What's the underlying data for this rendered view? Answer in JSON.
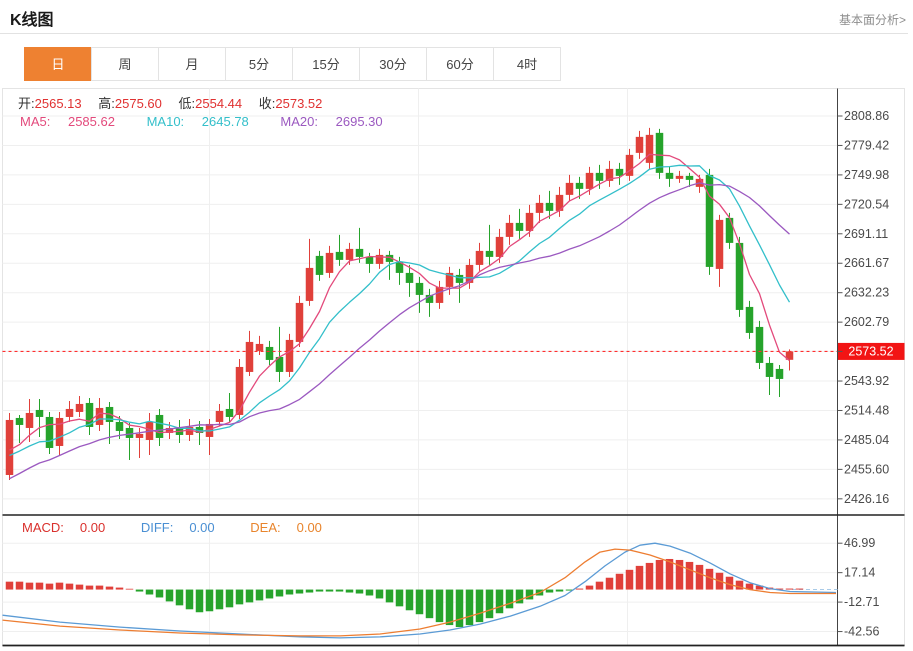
{
  "header": {
    "title": "K线图",
    "link": "基本面分析>"
  },
  "tabs": {
    "items": [
      {
        "label": "日",
        "active": true
      },
      {
        "label": "周",
        "active": false
      },
      {
        "label": "月",
        "active": false
      },
      {
        "label": "5分",
        "active": false
      },
      {
        "label": "15分",
        "active": false
      },
      {
        "label": "30分",
        "active": false
      },
      {
        "label": "60分",
        "active": false
      },
      {
        "label": "4时",
        "active": false
      }
    ]
  },
  "quote": {
    "open_label": "开:",
    "open": "2565.13",
    "high_label": "高:",
    "high": "2575.60",
    "low_label": "低:",
    "low": "2554.44",
    "close_label": "收:",
    "close": "2573.52"
  },
  "ma": {
    "ma5_label": "MA5:",
    "ma5": "2585.62",
    "ma10_label": "MA10:",
    "ma10": "2645.78",
    "ma20_label": "MA20:",
    "ma20": "2695.30"
  },
  "macd_readout": {
    "macd_label": "MACD:",
    "macd": "0.00",
    "diff_label": "DIFF:",
    "diff": "0.00",
    "dea_label": "DEA:",
    "dea": "0.00"
  },
  "colors": {
    "up": "#e0403a",
    "down": "#26a32b",
    "ma5": "#e34a7c",
    "ma10": "#33bfca",
    "ma20": "#9b59c0",
    "diff": "#5b9bd5",
    "dea": "#ed7d31",
    "tab_accent": "#ee8131",
    "price_badge": "#f21414",
    "price_line": "#ff2e2e",
    "grid": "#efefef",
    "axis": "#555555",
    "separator": "#222222",
    "tick_text": "#4a4a4a"
  },
  "chart_data": {
    "type": "candlestick+macd",
    "main": {
      "y_ticks": [
        2808.86,
        2779.42,
        2749.98,
        2720.54,
        2691.11,
        2661.67,
        2632.23,
        2602.79,
        2573.52,
        2543.92,
        2514.48,
        2485.04,
        2455.6,
        2426.16
      ],
      "current_price": 2573.52,
      "current_price_label": "2573.52",
      "ma_periods": [
        5,
        10,
        20
      ],
      "ma_seed": [
        2355,
        2362,
        2369,
        2376,
        2383,
        2390,
        2396,
        2402,
        2408,
        2414,
        2420,
        2426,
        2432,
        2438,
        2444,
        2450,
        2456,
        2461,
        2466,
        2470,
        2468,
        2472,
        2465,
        2470,
        2462
      ],
      "candles_format": [
        "open",
        "close",
        "high",
        "low"
      ],
      "candles": [
        [
          2450,
          2505,
          2512,
          2445
        ],
        [
          2507,
          2500,
          2510,
          2482
        ],
        [
          2497,
          2512,
          2526,
          2483
        ],
        [
          2515,
          2508,
          2526,
          2488
        ],
        [
          2508,
          2477,
          2513,
          2471
        ],
        [
          2479,
          2507,
          2513,
          2470
        ],
        [
          2508,
          2516,
          2524,
          2503
        ],
        [
          2513,
          2521,
          2529,
          2508
        ],
        [
          2522,
          2498,
          2527,
          2490
        ],
        [
          2500,
          2517,
          2527,
          2494
        ],
        [
          2518,
          2503,
          2523,
          2481
        ],
        [
          2503,
          2494,
          2509,
          2486
        ],
        [
          2497,
          2487,
          2502,
          2465
        ],
        [
          2487,
          2491,
          2497,
          2467
        ],
        [
          2485,
          2503,
          2512,
          2470
        ],
        [
          2510,
          2487,
          2516,
          2479
        ],
        [
          2492,
          2497,
          2503,
          2486
        ],
        [
          2497,
          2490,
          2505,
          2482
        ],
        [
          2490,
          2498,
          2506,
          2484
        ],
        [
          2498,
          2492,
          2504,
          2480
        ],
        [
          2488,
          2501,
          2506,
          2470
        ],
        [
          2503,
          2514,
          2521,
          2499
        ],
        [
          2516,
          2508,
          2532,
          2503
        ],
        [
          2510,
          2558,
          2566,
          2506
        ],
        [
          2553,
          2583,
          2594,
          2549
        ],
        [
          2574,
          2581,
          2589,
          2570
        ],
        [
          2578,
          2565,
          2584,
          2560
        ],
        [
          2568,
          2553,
          2598,
          2543
        ],
        [
          2553,
          2585,
          2591,
          2548
        ],
        [
          2583,
          2622,
          2629,
          2578
        ],
        [
          2624,
          2657,
          2686,
          2619
        ],
        [
          2669,
          2650,
          2674,
          2644
        ],
        [
          2652,
          2672,
          2679,
          2647
        ],
        [
          2673,
          2665,
          2690,
          2659
        ],
        [
          2665,
          2676,
          2682,
          2660
        ],
        [
          2676,
          2668,
          2697,
          2662
        ],
        [
          2668,
          2661,
          2672,
          2652
        ],
        [
          2661,
          2670,
          2676,
          2656
        ],
        [
          2670,
          2663,
          2674,
          2645
        ],
        [
          2663,
          2652,
          2668,
          2640
        ],
        [
          2652,
          2642,
          2660,
          2628
        ],
        [
          2642,
          2630,
          2648,
          2612
        ],
        [
          2630,
          2622,
          2636,
          2608
        ],
        [
          2622,
          2638,
          2644,
          2616
        ],
        [
          2638,
          2652,
          2658,
          2630
        ],
        [
          2650,
          2642,
          2656,
          2622
        ],
        [
          2642,
          2660,
          2666,
          2636
        ],
        [
          2660,
          2674,
          2682,
          2654
        ],
        [
          2674,
          2668,
          2700,
          2660
        ],
        [
          2668,
          2688,
          2696,
          2662
        ],
        [
          2688,
          2702,
          2710,
          2680
        ],
        [
          2702,
          2694,
          2716,
          2686
        ],
        [
          2694,
          2712,
          2720,
          2688
        ],
        [
          2712,
          2722,
          2730,
          2702
        ],
        [
          2722,
          2714,
          2734,
          2706
        ],
        [
          2714,
          2730,
          2738,
          2708
        ],
        [
          2730,
          2742,
          2750,
          2724
        ],
        [
          2742,
          2736,
          2748,
          2726
        ],
        [
          2736,
          2752,
          2758,
          2730
        ],
        [
          2752,
          2744,
          2760,
          2736
        ],
        [
          2744,
          2756,
          2764,
          2738
        ],
        [
          2756,
          2749,
          2762,
          2740
        ],
        [
          2749,
          2770,
          2776,
          2744
        ],
        [
          2772,
          2788,
          2794,
          2766
        ],
        [
          2762,
          2790,
          2797,
          2756
        ],
        [
          2792,
          2752,
          2796,
          2746
        ],
        [
          2752,
          2746,
          2758,
          2738
        ],
        [
          2746,
          2749,
          2754,
          2742
        ],
        [
          2749,
          2745,
          2752,
          2738
        ],
        [
          2738,
          2746,
          2750,
          2732
        ],
        [
          2750,
          2658,
          2756,
          2650
        ],
        [
          2656,
          2705,
          2710,
          2638
        ],
        [
          2707,
          2682,
          2712,
          2676
        ],
        [
          2682,
          2615,
          2688,
          2608
        ],
        [
          2618,
          2592,
          2624,
          2586
        ],
        [
          2598,
          2562,
          2604,
          2556
        ],
        [
          2562,
          2548,
          2568,
          2530
        ],
        [
          2556,
          2546,
          2560,
          2528
        ],
        [
          2565.13,
          2573.52,
          2575.6,
          2554.44
        ]
      ]
    },
    "macd": {
      "y_ticks": [
        46.99,
        17.14,
        -12.71,
        -42.56
      ],
      "macd_value": 0.0,
      "diff_value": 0.0,
      "dea_value": 0.0,
      "histogram": [
        8,
        8,
        7,
        7,
        6,
        7,
        6,
        5,
        4,
        4,
        3,
        2,
        0,
        -2,
        -5,
        -8,
        -12,
        -16,
        -20,
        -23,
        -22,
        -20,
        -18,
        -15,
        -13,
        -11,
        -9,
        -7,
        -5,
        -4,
        -3,
        -2,
        -2,
        -2,
        -3,
        -4,
        -6,
        -9,
        -13,
        -17,
        -21,
        -25,
        -29,
        -33,
        -36,
        -38,
        -36,
        -33,
        -29,
        -24,
        -19,
        -14,
        -10,
        -6,
        -3,
        -2,
        -1,
        1,
        4,
        8,
        12,
        16,
        20,
        24,
        27,
        30,
        31,
        30,
        28,
        25,
        21,
        17,
        13,
        9,
        6,
        4,
        2,
        1,
        1,
        1
      ],
      "diff_line": [
        [
          0,
          -26
        ],
        [
          60,
          -33
        ],
        [
          120,
          -38
        ],
        [
          180,
          -42
        ],
        [
          240,
          -45
        ],
        [
          300,
          -48
        ],
        [
          340,
          -49
        ],
        [
          380,
          -48
        ],
        [
          420,
          -45
        ],
        [
          450,
          -41
        ],
        [
          480,
          -35
        ],
        [
          510,
          -27
        ],
        [
          540,
          -17
        ],
        [
          565,
          -6
        ],
        [
          585,
          8
        ],
        [
          605,
          24
        ],
        [
          625,
          38
        ],
        [
          640,
          45
        ],
        [
          655,
          47
        ],
        [
          670,
          44
        ],
        [
          690,
          37
        ],
        [
          710,
          27
        ],
        [
          730,
          16
        ],
        [
          750,
          7
        ],
        [
          770,
          1
        ],
        [
          790,
          -2
        ],
        [
          836,
          -3
        ]
      ],
      "dea_line": [
        [
          0,
          -31
        ],
        [
          60,
          -37
        ],
        [
          120,
          -41
        ],
        [
          180,
          -44
        ],
        [
          240,
          -46
        ],
        [
          300,
          -47
        ],
        [
          340,
          -47
        ],
        [
          380,
          -45
        ],
        [
          420,
          -40
        ],
        [
          450,
          -33
        ],
        [
          480,
          -24
        ],
        [
          510,
          -14
        ],
        [
          540,
          -3
        ],
        [
          565,
          12
        ],
        [
          585,
          28
        ],
        [
          600,
          38
        ],
        [
          615,
          41
        ],
        [
          630,
          40
        ],
        [
          650,
          35
        ],
        [
          670,
          28
        ],
        [
          690,
          20
        ],
        [
          710,
          12
        ],
        [
          730,
          5
        ],
        [
          750,
          0
        ],
        [
          770,
          -3
        ],
        [
          790,
          -4
        ],
        [
          836,
          -4
        ]
      ]
    }
  }
}
